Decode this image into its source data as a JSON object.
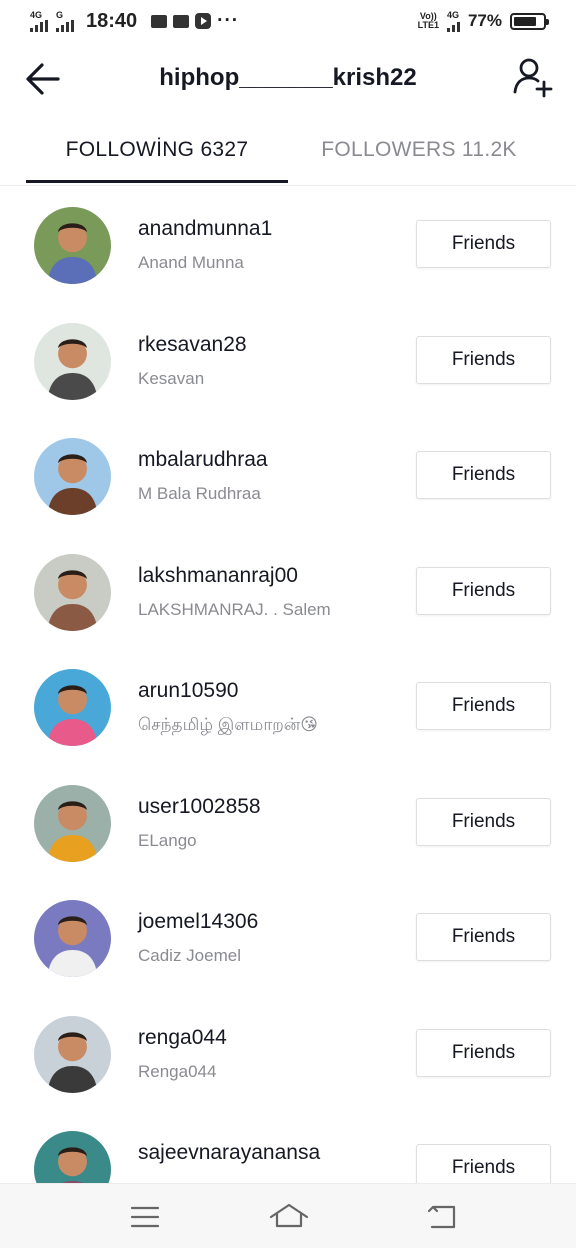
{
  "status_bar": {
    "sim1_net": "4G",
    "sim2_net": "G",
    "time": "18:40",
    "more": "···",
    "volte_top": "Vo))",
    "volte_bottom": "LTE1",
    "net_right": "4G",
    "battery": "77%",
    "battery_level": 0.77
  },
  "header": {
    "title": "hiphop_______krish22"
  },
  "tabs": {
    "following": "FOLLOWİNG 6327",
    "followers": "FOLLOWERS 11.2K"
  },
  "users": [
    {
      "username": "anandmunna1",
      "nickname": "Anand Munna",
      "button": "Friends",
      "avatar_bg": "#7a9a5a",
      "avatar_fg": "#5a6fb8"
    },
    {
      "username": "rkesavan28",
      "nickname": "Kesavan",
      "button": "Friends",
      "avatar_bg": "#dfe6e0",
      "avatar_fg": "#4a4a4a"
    },
    {
      "username": "mbalarudhraa",
      "nickname": "M Bala Rudhraa",
      "button": "Friends",
      "avatar_bg": "#9fc8e8",
      "avatar_fg": "#6b3f2a"
    },
    {
      "username": "lakshmananraj00",
      "nickname": "LAKSHMANRAJ. . Salem",
      "button": "Friends",
      "avatar_bg": "#c9ccc4",
      "avatar_fg": "#8a5a44"
    },
    {
      "username": "arun10590",
      "nickname": "செந்தமிழ் இளமாறன்😘",
      "button": "Friends",
      "avatar_bg": "#4aa8d8",
      "avatar_fg": "#e85a8a"
    },
    {
      "username": "user1002858",
      "nickname": "ELango",
      "button": "Friends",
      "avatar_bg": "#9ab0a8",
      "avatar_fg": "#e8a020"
    },
    {
      "username": "joemel14306",
      "nickname": "Cadiz Joemel",
      "button": "Friends",
      "avatar_bg": "#7a7ac0",
      "avatar_fg": "#f0f0f0"
    },
    {
      "username": "renga044",
      "nickname": "Renga044",
      "button": "Friends",
      "avatar_bg": "#c8d0d8",
      "avatar_fg": "#3a3a3a"
    },
    {
      "username": "sajeevnarayanansa",
      "nickname": "",
      "button": "Friends",
      "avatar_bg": "#3a8a8a",
      "avatar_fg": "#8a4a6a"
    }
  ]
}
